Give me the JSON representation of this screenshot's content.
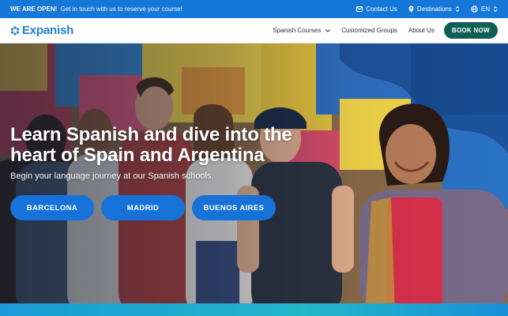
{
  "topbar": {
    "announcement_bold": "WE ARE OPEN!",
    "announcement_text": "Get in touch with us to reserve your course!",
    "contact_label": "Contact Us",
    "destinations_label": "Destinations",
    "language_label": "EN",
    "bg_color": "#1577d8"
  },
  "navbar": {
    "logo_text": "Expanish",
    "items": [
      {
        "label": "Spanish Courses",
        "has_dropdown": true
      },
      {
        "label": "Customized Groups"
      },
      {
        "label": "About Us"
      }
    ],
    "cta_label": "BOOK NOW",
    "cta_color": "#0d5e54"
  },
  "hero": {
    "headline": "Learn Spanish and dive into the heart of Spain and Argentina",
    "subheadline": "Begin your language journey at our Spanish schools.",
    "city_buttons": [
      "BARCELONA",
      "MADRID",
      "BUENOS AIRES"
    ],
    "button_color": "#1672d8"
  }
}
